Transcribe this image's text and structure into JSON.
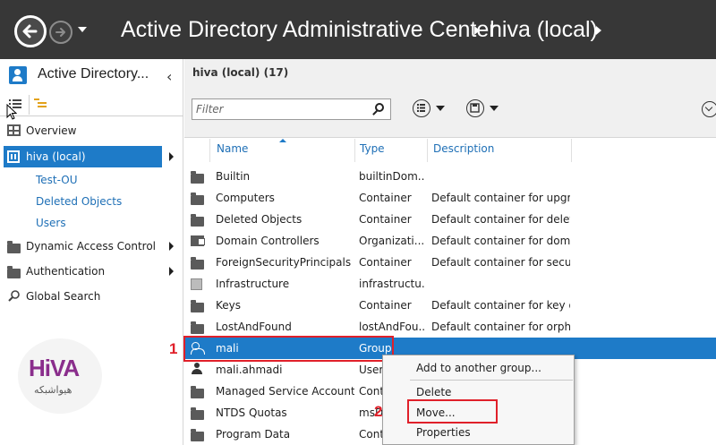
{
  "titlebar": {
    "app_title": "Active Directory Administrative Center",
    "location": "hiva (local)"
  },
  "left_panel": {
    "title": "Active Directory...",
    "nav": [
      {
        "label": "Overview",
        "icon": "overview-icon"
      },
      {
        "label": "hiva (local)",
        "icon": "domain-icon",
        "selected": true
      },
      {
        "label": "Dynamic Access Control",
        "icon": "folder-icon"
      },
      {
        "label": "Authentication",
        "icon": "folder-icon"
      },
      {
        "label": "Global Search",
        "icon": "search-icon"
      }
    ],
    "sub_items": [
      "Test-OU",
      "Deleted Objects",
      "Users"
    ]
  },
  "logo": {
    "main": "HiVA",
    "sub": "هیواشبکه"
  },
  "main": {
    "header": "hiva (local)",
    "count": "(17)",
    "filter_placeholder": "Filter",
    "columns": {
      "name": "Name",
      "type": "Type",
      "description": "Description"
    },
    "rows": [
      {
        "name": "Builtin",
        "type": "builtinDom...",
        "description": "",
        "icon": "folder-icon"
      },
      {
        "name": "Computers",
        "type": "Container",
        "description": "Default container for upgr...",
        "icon": "folder-icon"
      },
      {
        "name": "Deleted Objects",
        "type": "Container",
        "description": "Default container for delet...",
        "icon": "folder-icon"
      },
      {
        "name": "Domain Controllers",
        "type": "Organizati...",
        "description": "Default container for dom...",
        "icon": "ou-icon"
      },
      {
        "name": "ForeignSecurityPrincipals",
        "type": "Container",
        "description": "Default container for secur...",
        "icon": "folder-icon"
      },
      {
        "name": "Infrastructure",
        "type": "infrastructu...",
        "description": "",
        "icon": "infrastructure-icon"
      },
      {
        "name": "Keys",
        "type": "Container",
        "description": "Default container for key o...",
        "icon": "folder-icon"
      },
      {
        "name": "LostAndFound",
        "type": "lostAndFou...",
        "description": "Default container for orph...",
        "icon": "folder-icon"
      },
      {
        "name": "mali",
        "type": "Group",
        "description": "",
        "icon": "group-icon",
        "selected": true
      },
      {
        "name": "mali.ahmadi",
        "type": "User",
        "description": "",
        "icon": "user-icon"
      },
      {
        "name": "Managed Service Accounts",
        "type": "Cont",
        "description": "",
        "icon": "folder-icon"
      },
      {
        "name": "NTDS Quotas",
        "type": "msD",
        "description": "",
        "icon": "folder-icon"
      },
      {
        "name": "Program Data",
        "type": "Cont",
        "description": "",
        "icon": "folder-icon"
      }
    ]
  },
  "context_menu": {
    "items": [
      "Add to another group...",
      "Delete",
      "Move...",
      "Properties"
    ]
  },
  "annotations": {
    "step1": "1",
    "step2": "2",
    "highlight_color": "#e0202a"
  },
  "colors": {
    "accent": "#1e7bc8",
    "titlebar": "#373737",
    "link": "#1e6fb6"
  }
}
